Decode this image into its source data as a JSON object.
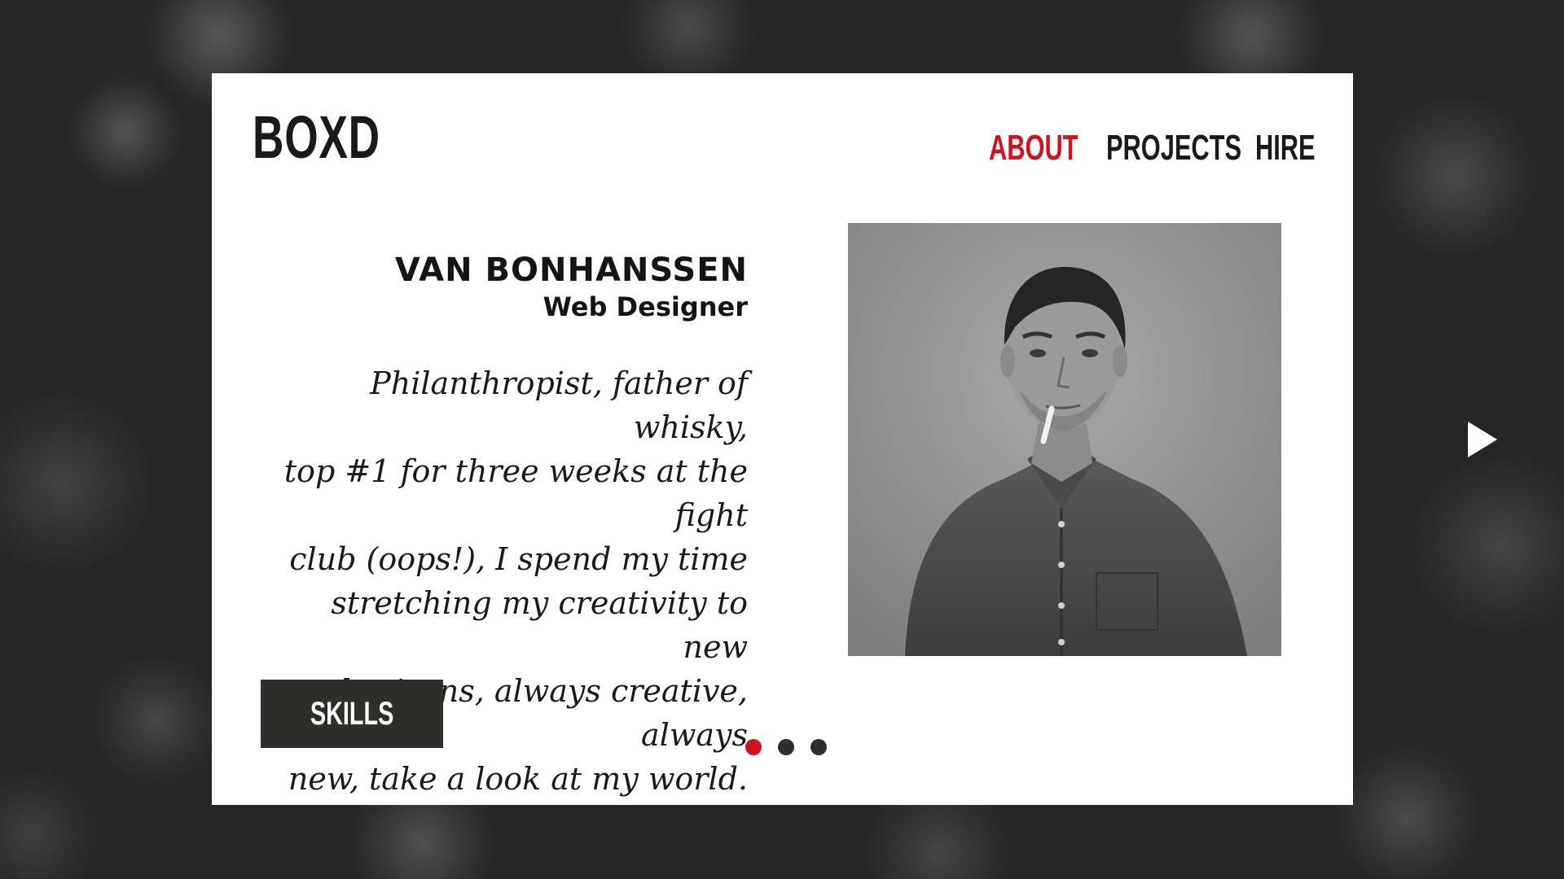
{
  "brand": {
    "logo": "BOXD"
  },
  "nav": {
    "items": [
      {
        "label": "ABOUT",
        "active": true
      },
      {
        "label": "PROJECTS",
        "active": false
      },
      {
        "label": "HIRE",
        "active": false
      }
    ]
  },
  "profile": {
    "name": "VAN BONHANSSEN",
    "role": "Web Designer",
    "bio_lines": [
      "Philanthropist, father of whisky,",
      "top #1 for three weeks at the fight",
      "club (oops!), I spend my time",
      "stretching my creativity to new",
      "horizons, always creative, always",
      "new, take a look at my world."
    ]
  },
  "actions": {
    "skills_label": "SKILLS"
  },
  "slider": {
    "total": 3,
    "active_index": 0,
    "next_icon": "play-arrow-icon"
  },
  "colors": {
    "accent": "#d0121e",
    "dark": "#2e2e2a",
    "card": "#ffffff"
  }
}
